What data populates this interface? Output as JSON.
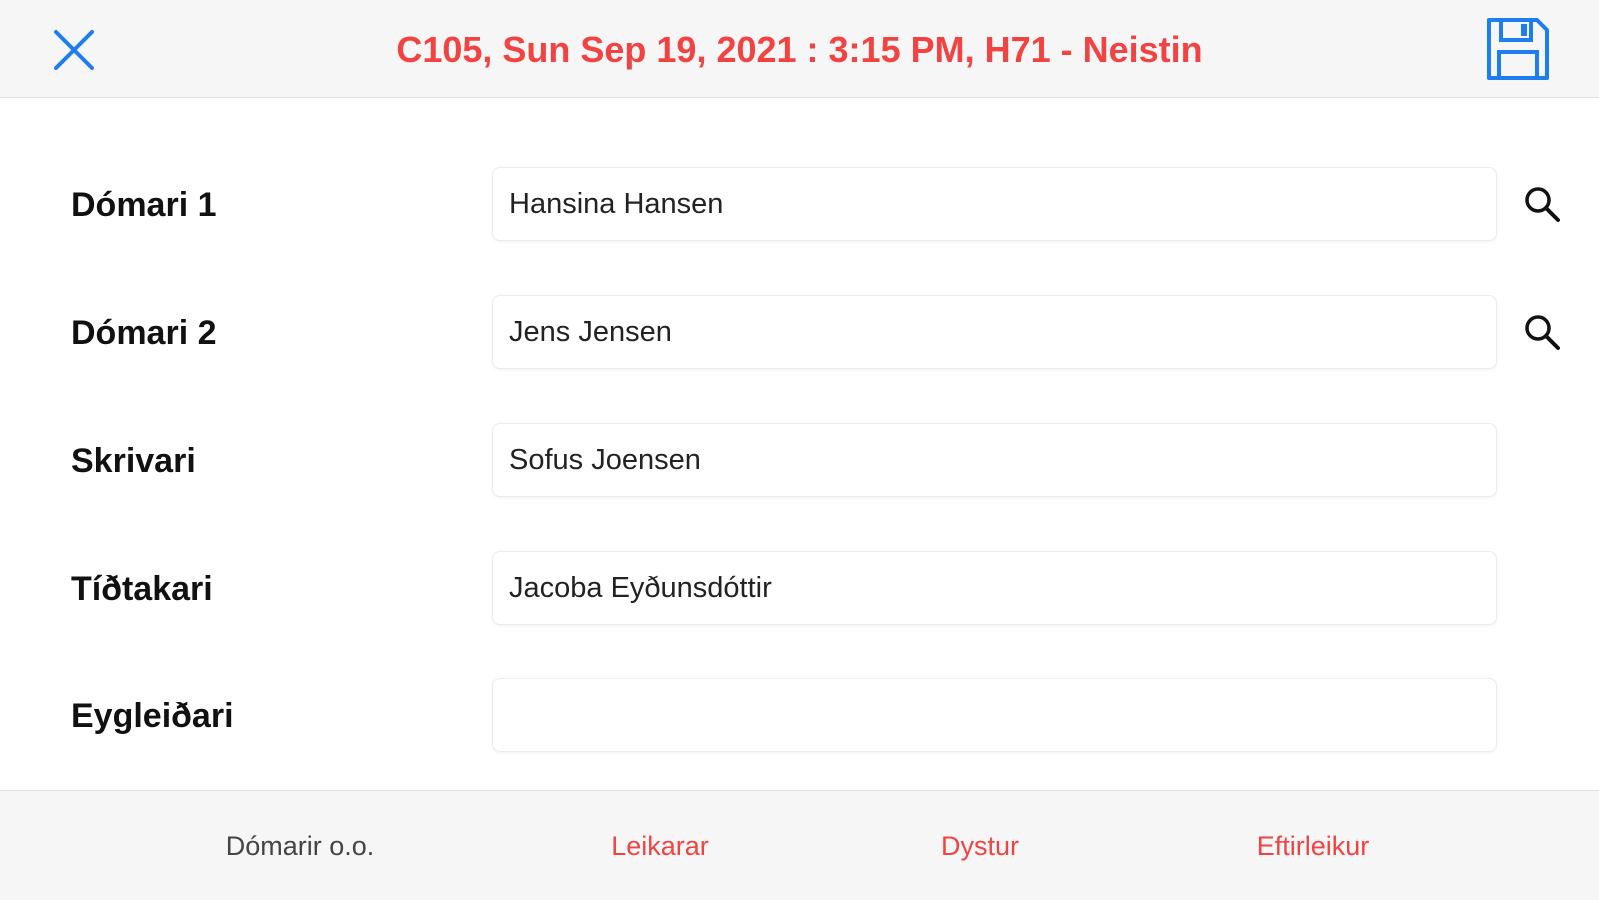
{
  "header": {
    "title": "C105, Sun Sep 19, 2021 : 3:15 PM, H71 - Neistin",
    "close_icon": "close-icon",
    "save_icon": "floppy-disk-save-icon",
    "accent_color": "#f24343",
    "icon_color": "#1e7ef0"
  },
  "form": {
    "rows": [
      {
        "label": "Dómari 1",
        "value": "Hansina Hansen",
        "has_search": true
      },
      {
        "label": "Dómari 2",
        "value": "Jens Jensen",
        "has_search": true
      },
      {
        "label": "Skrivari",
        "value": "Sofus Joensen",
        "has_search": false
      },
      {
        "label": "Tíðtakari",
        "value": "Jacoba Eyðunsdóttir",
        "has_search": false
      },
      {
        "label": "Eygleiðari",
        "value": "",
        "has_search": false
      }
    ],
    "search_icon": "magnifier-search-icon"
  },
  "tabs": [
    {
      "label": "Dómarir o.o.",
      "active": true
    },
    {
      "label": "Leikarar",
      "active": false
    },
    {
      "label": "Dystur",
      "active": false
    },
    {
      "label": "Eftirleikur",
      "active": false
    }
  ]
}
